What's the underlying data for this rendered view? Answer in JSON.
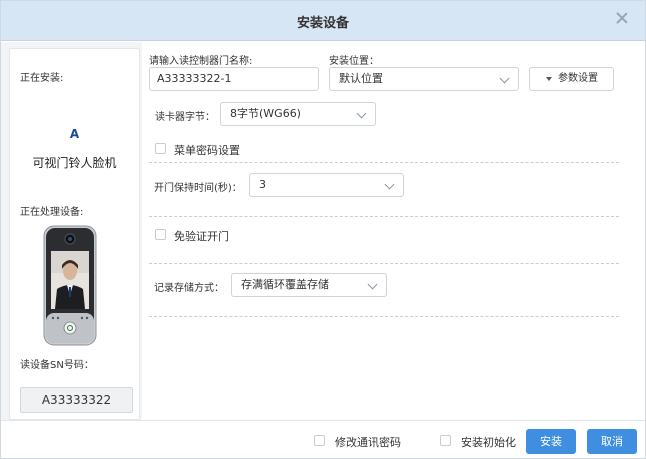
{
  "dialog": {
    "title": "安装设备"
  },
  "left": {
    "installing_label": "正在安装:",
    "device_letter": "A",
    "device_name": "可视门铃人脸机",
    "processing_label": "正在处理设备:",
    "sn_label": "读设备SN号码：",
    "sn_value": "A33333322"
  },
  "form": {
    "door_name_label": "请输入读控制器门名称:",
    "door_name_value": "A33333322-1",
    "location_label": "安装位置：",
    "location_value": "默认位置",
    "param_button": "参数设置",
    "reader_bytes_label": "读卡器字节：",
    "reader_bytes_value": "8字节(WG66)",
    "menu_password_label": "菜单密码设置",
    "door_hold_label": "开门保持时间(秒)：",
    "door_hold_value": "3",
    "free_auth_label": "免验证开门",
    "record_storage_label": "记录存储方式：",
    "record_storage_value": "存满循环覆盖存储"
  },
  "footer": {
    "modify_password_label": "修改通讯密码",
    "install_init_label": "安装初始化",
    "install_button": "安装",
    "cancel_button": "取消"
  },
  "colors": {
    "titlebar": "#d7e6f5",
    "accent": "#3f8ee0"
  }
}
